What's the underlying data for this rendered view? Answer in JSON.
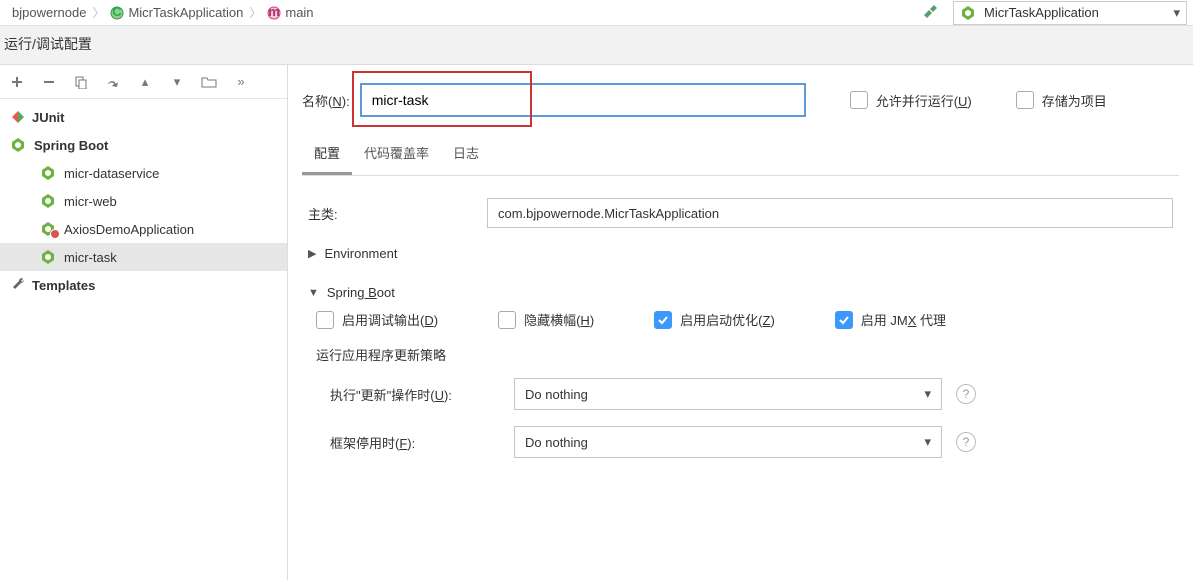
{
  "breadcrumb": {
    "items": [
      "bjpowernode",
      "MicrTaskApplication",
      "main"
    ]
  },
  "run_config_selected": "MicrTaskApplication",
  "dialog_title": "运行/调试配置",
  "tree": {
    "junit": "JUnit",
    "spring_boot": "Spring Boot",
    "children": [
      "micr-dataservice",
      "micr-web",
      "AxiosDemoApplication",
      "micr-task"
    ],
    "templates": "Templates"
  },
  "form": {
    "name_label_prefix": "名称(",
    "name_label_u": "N",
    "name_label_suffix": "):",
    "name_value": "micr-task",
    "allow_parallel_prefix": "允许并行运行(",
    "allow_parallel_u": "U",
    "allow_parallel_suffix": ")",
    "store_project": "存储为项目",
    "tabs": [
      "配置",
      "代码覆盖率",
      "日志"
    ],
    "main_class_label": "主类:",
    "main_class_value": "com.bjpowernode.MicrTaskApplication",
    "env_header": "Environment",
    "sb_header_prefix": "Spring",
    "sb_header_u": " B",
    "sb_header_suffix": "oot",
    "enable_debug_prefix": "启用调试输出(",
    "enable_debug_u": "D",
    "enable_debug_suffix": ")",
    "hide_banner_prefix": "隐藏横幅(",
    "hide_banner_u": "H",
    "hide_banner_suffix": ")",
    "enable_optimize_prefix": "启用启动优化(",
    "enable_optimize_u": "Z",
    "enable_optimize_suffix": ")",
    "enable_jmx_prefix": "启用 JM",
    "enable_jmx_u": "X",
    "enable_jmx_suffix": " 代理",
    "update_policy_label": "运行应用程序更新策略",
    "on_update_prefix": "执行\"更新\"操作时(",
    "on_update_u": "U",
    "on_update_suffix": "):",
    "on_update_value": "Do nothing",
    "on_frame_deactivate_prefix": "框架停用时(",
    "on_frame_deactivate_u": "F",
    "on_frame_deactivate_suffix": "):",
    "on_frame_deactivate_value": "Do nothing"
  }
}
